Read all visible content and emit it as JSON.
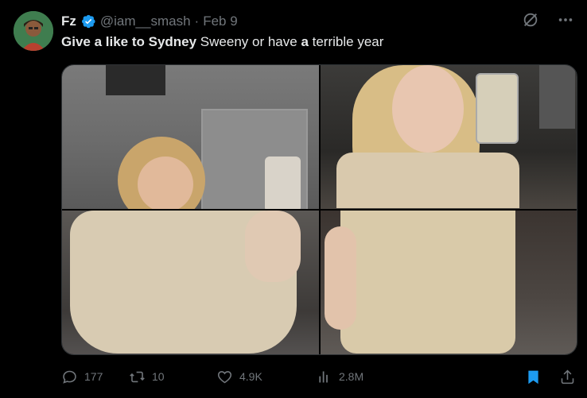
{
  "author": {
    "name": "Fz",
    "handle": "@iam__smash",
    "separator": "·",
    "date": "Feb 9",
    "verified_color": "#1d9bf0"
  },
  "tweet": {
    "text_parts": [
      {
        "text": "Give a like to Sydney",
        "bold": true
      },
      {
        "text": " Sweeny or have ",
        "bold": false
      },
      {
        "text": "a",
        "bold": true
      },
      {
        "text": " terrible year",
        "bold": false
      }
    ]
  },
  "media": {
    "photo_count": 4
  },
  "stats": {
    "replies": "177",
    "retweets": "10",
    "likes": "4.9K",
    "views": "2.8M"
  },
  "icons": {
    "reply": "reply-icon",
    "retweet": "retweet-icon",
    "like": "heart-icon",
    "views": "views-icon",
    "bookmark": "bookmark-icon",
    "share": "share-icon",
    "grok": "grok-icon",
    "more": "more-icon"
  },
  "colors": {
    "background": "#000000",
    "text": "#e7e9ea",
    "muted": "#71767b",
    "accent": "#1d9bf0"
  }
}
